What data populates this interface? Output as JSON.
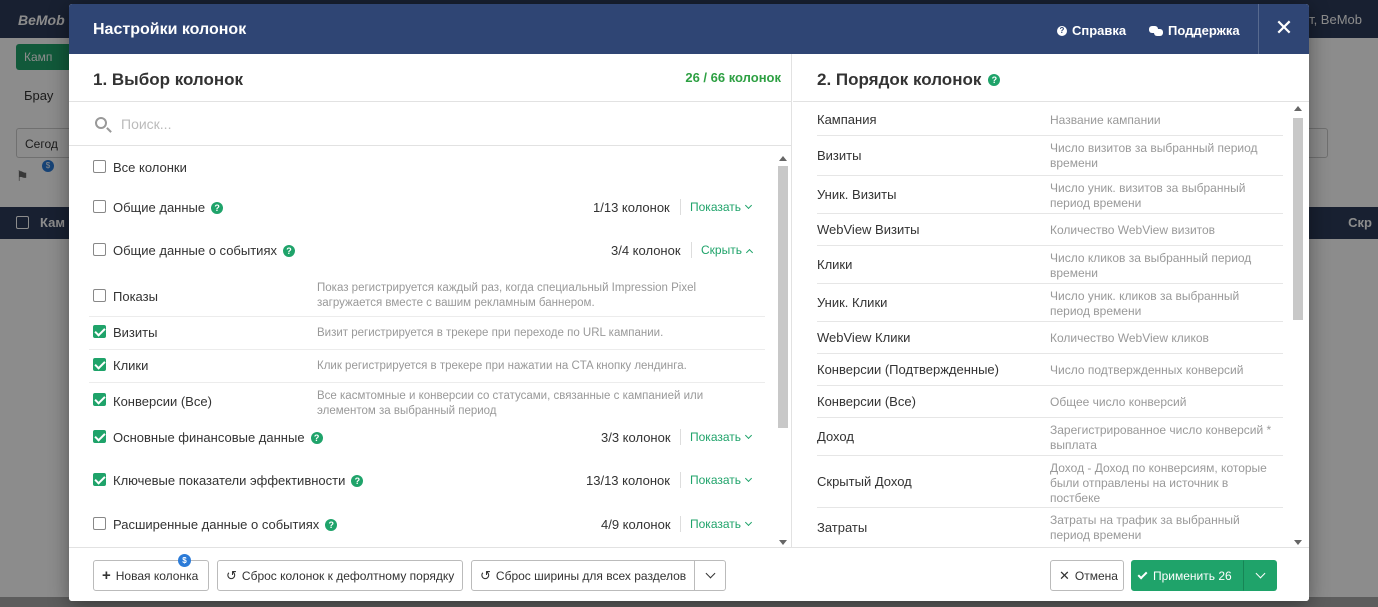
{
  "background": {
    "logo": "BeMob",
    "user": "ет, BeMob",
    "green_button": "Камп",
    "tab": "Брау",
    "date": "Сегод",
    "table_left": "Кам",
    "table_right": "Скр"
  },
  "modal": {
    "title": "Настройки колонок",
    "help": "Справка",
    "support": "Поддержка",
    "close": "✕"
  },
  "left": {
    "title": "1. Выбор колонок",
    "count": "26 / 66 колонок",
    "search_placeholder": "Поиск...",
    "all_columns": "Все колонки",
    "groups": [
      {
        "label": "Общие данные",
        "count": "1/13 колонок",
        "toggle": "Показать",
        "checked": false
      },
      {
        "label": "Общие данные о событиях",
        "count": "3/4 колонок",
        "toggle": "Скрыть",
        "checked": false
      },
      {
        "label": "Основные финансовые данные",
        "count": "3/3 колонок",
        "toggle": "Показать",
        "checked": true
      },
      {
        "label": "Ключевые показатели эффективности",
        "count": "13/13 колонок",
        "toggle": "Показать",
        "checked": true
      },
      {
        "label": "Расширенные данные о событиях",
        "count": "4/9 колонок",
        "toggle": "Показать",
        "checked": false
      }
    ],
    "sub_items": [
      {
        "label": "Показы",
        "desc": "Показ регистрируется каждый раз, когда специальный Impression Pixel загружается вместе с вашим рекламным баннером.",
        "checked": false
      },
      {
        "label": "Визиты",
        "desc": "Визит регистрируется в трекере при переходе по URL кампании.",
        "checked": true
      },
      {
        "label": "Клики",
        "desc": "Клик регистрируется в трекере при нажатии на CTA кнопку лендинга.",
        "checked": true
      },
      {
        "label": "Конверсии (Все)",
        "desc": "Все касмтомные и конверсии со статусами, связанные с кампанией или элементом за выбранный период",
        "checked": true
      }
    ]
  },
  "right": {
    "title": "2. Порядок колонок",
    "rows": [
      {
        "name": "Кампания",
        "desc": "Название кампании"
      },
      {
        "name": "Визиты",
        "desc": "Число визитов за выбранный период времени"
      },
      {
        "name": "Уник. Визиты",
        "desc": "Число уник. визитов за выбранный период времени"
      },
      {
        "name": "WebView Визиты",
        "desc": "Количество WebView визитов"
      },
      {
        "name": "Клики",
        "desc": "Число кликов за выбранный период времени"
      },
      {
        "name": "Уник. Клики",
        "desc": "Число уник. кликов за выбранный период времени"
      },
      {
        "name": "WebView Клики",
        "desc": "Количество WebView кликов"
      },
      {
        "name": "Конверсии (Подтвержденные)",
        "desc": "Число подтвержденных конверсий"
      },
      {
        "name": "Конверсии (Все)",
        "desc": "Общее число конверсий"
      },
      {
        "name": "Доход",
        "desc": "Зарегистрированное число конверсий * выплата"
      },
      {
        "name": "Скрытый Доход",
        "desc": "Доход - Доход по конверсиям, которые были отправлены на источник в постбеке"
      },
      {
        "name": "Затраты",
        "desc": "Затраты на трафик за выбранный период времени"
      }
    ]
  },
  "footer": {
    "new_column": "Новая колонка",
    "new_badge": "$",
    "reset_columns": "Сброс колонок к дефолтному порядку",
    "reset_width": "Сброс ширины для всех разделов",
    "cancel": "Отмена",
    "apply": "Применить 26"
  },
  "colors": {
    "header_bg": "#2f4574",
    "accent_green": "#1fa36a",
    "count_green": "#2ea043"
  }
}
